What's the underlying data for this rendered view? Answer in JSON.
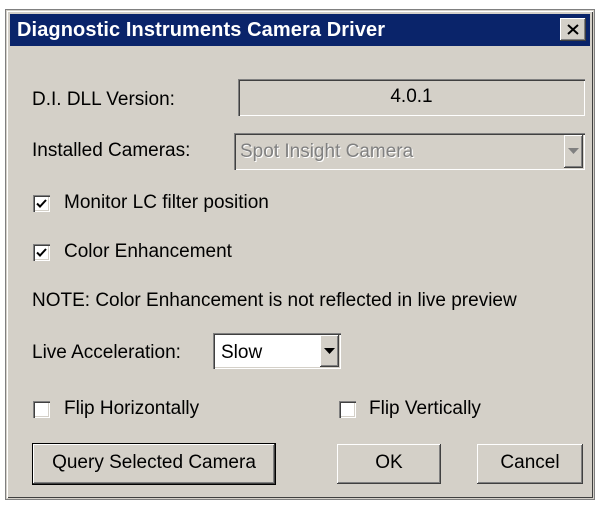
{
  "window": {
    "title": "Diagnostic Instruments Camera Driver"
  },
  "dll_version": {
    "label": "D.I. DLL Version:",
    "value": "4.0.1"
  },
  "installed_cameras": {
    "label": "Installed Cameras:",
    "selected": "Spot Insight Camera"
  },
  "monitor_lc": {
    "label": "Monitor LC filter position",
    "checked": true
  },
  "color_enhancement": {
    "label": "Color Enhancement",
    "checked": true
  },
  "note": "NOTE: Color Enhancement is not reflected in live preview",
  "live_acceleration": {
    "label": "Live Acceleration:",
    "selected": "Slow"
  },
  "flip_horizontal": {
    "label": "Flip Horizontally",
    "checked": false
  },
  "flip_vertical": {
    "label": "Flip Vertically",
    "checked": false
  },
  "buttons": {
    "query": "Query Selected Camera",
    "ok": "OK",
    "cancel": "Cancel"
  },
  "icons": {
    "close": "close-icon",
    "check": "checkmark-icon",
    "dropdown": "chevron-down-icon"
  },
  "colors": {
    "titlebar": "#0a246a",
    "face": "#d4d0c8"
  }
}
